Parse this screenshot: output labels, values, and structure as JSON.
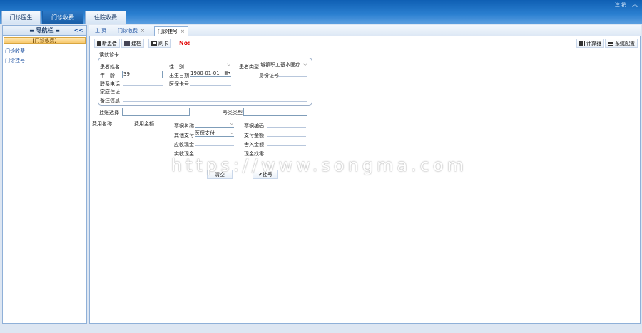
{
  "top_tabs": [
    "门诊医生",
    "门诊收费",
    "住院收费"
  ],
  "top_links": "注 销",
  "top_caret": "︽",
  "sidebar": {
    "title": "导航栏",
    "menu_icon": "≡",
    "collapse": "<<",
    "group": "门诊收费",
    "items": [
      "门诊收费",
      "门诊挂号"
    ]
  },
  "page_tabs": [
    {
      "label": "主 页"
    },
    {
      "label": "门诊收费",
      "close": "×"
    },
    {
      "label": "门诊挂号",
      "close": "×"
    }
  ],
  "toolbar": {
    "new_patient": "新患者",
    "archive": "建档",
    "swipe_card": "刷卡",
    "no_label": "No:",
    "calculator": "计算器",
    "settings": "系统配置"
  },
  "form": {
    "card_label": "读就诊卡",
    "name_label": "患者姓名",
    "gender_label": "性　别",
    "type_label": "患者类型",
    "type_value": "城镇职工基本医疗",
    "age_label": "年　龄",
    "age_value": "39",
    "birth_label": "出生日期",
    "birth_value": "1980-01-01",
    "id_label": "身份证号",
    "phone_label": "联系电话",
    "insurance_label": "医保卡号",
    "address_label": "家庭住址",
    "remark_label": "备注信息",
    "dept_label": "挂账选择",
    "category_label": "号类类型"
  },
  "fee_table": {
    "col1": "费用名称",
    "col2": "费用金额"
  },
  "fee_form": {
    "bill_name": "票据名称",
    "bill_code": "票据编码",
    "other_pay": "其他支付",
    "other_pay_value": "医保支付",
    "pay_amount": "支付金额",
    "receivable": "应收现金",
    "rounding": "舍入金额",
    "actual_cash": "实收现金",
    "change": "现金找零",
    "clear_btn": "清空",
    "register_btn": "挂号"
  },
  "watermark": "https://www.songma.com",
  "colors": {
    "accent": "#1a5fa8",
    "no_label": "#e00000",
    "group": "#f7c667"
  }
}
